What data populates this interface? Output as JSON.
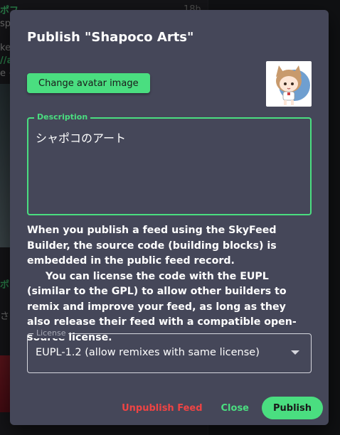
{
  "background": {
    "time_label": "18h",
    "snippets": [
      "ポフ",
      "spo",
      "ke",
      "//a",
      "e <",
      "ポフ",
      "さめ",
      "en",
      "bl"
    ]
  },
  "dialog": {
    "title": "Publish \"Shapoco Arts\"",
    "change_avatar_label": "Change avatar image",
    "avatar_icon": "cat-girl-avatar",
    "description": {
      "label": "Description",
      "value": "シャポコのアート"
    },
    "info_paragraph_1": "When you publish a feed using the SkyFeed Builder, the source code (building blocks) is embedded in the public feed record.",
    "info_paragraph_2": "You can license the code with the EUPL (similar to the GPL) to allow other builders to remix and improve your feed, as long as they also release their feed with a compatible open-source license.",
    "license": {
      "label": "License",
      "selected": "EUPL-1.2 (allow remixes with same license)"
    },
    "actions": {
      "unpublish_label": "Unpublish Feed",
      "close_label": "Close",
      "publish_label": "Publish"
    },
    "colors": {
      "accent": "#4ade80",
      "danger": "#ef4444",
      "surface": "#454759"
    }
  }
}
